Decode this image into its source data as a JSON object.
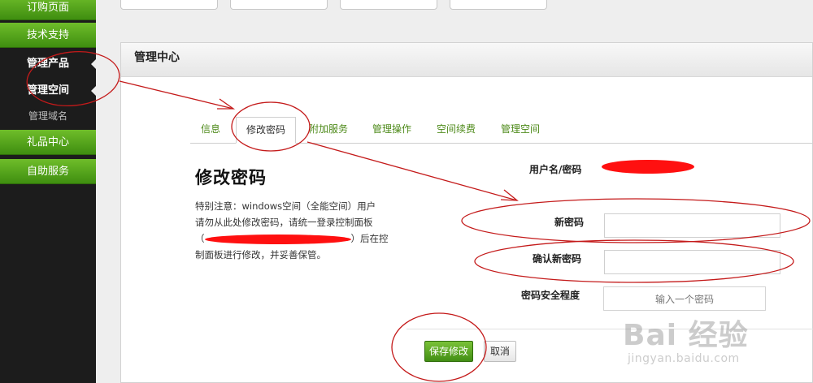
{
  "sidebar": {
    "items": [
      {
        "label": "订购页面"
      },
      {
        "label": "技术支持"
      },
      {
        "label": "管理产品"
      },
      {
        "label": "管理空间"
      },
      {
        "label": "管理域名"
      },
      {
        "label": "礼品中心"
      },
      {
        "label": "自助服务"
      }
    ]
  },
  "panel": {
    "title": "管理中心"
  },
  "tabs": [
    {
      "label": "信息"
    },
    {
      "label": "修改密码"
    },
    {
      "label": "附加服务"
    },
    {
      "label": "管理操作"
    },
    {
      "label": "空间续费"
    },
    {
      "label": "管理空间"
    }
  ],
  "section": {
    "title": "修改密码",
    "notice_line1": "特别注意：windows空间（全能空间）用户",
    "notice_line2": "请勿从此处修改密码，请统一登录控制面板",
    "notice_line3_prefix": "（",
    "notice_line3_suffix": "）后在控",
    "notice_line4": "制面板进行修改，并妥善保管。"
  },
  "form": {
    "username_label": "用户名/密码",
    "new_password_label": "新密码",
    "new_password_value": "",
    "confirm_password_label": "确认新密码",
    "confirm_password_value": "",
    "strength_label": "密码安全程度",
    "strength_placeholder": "输入一个密码"
  },
  "buttons": {
    "save": "保存修改",
    "cancel": "取消"
  },
  "watermark": {
    "main": "Bai 经验",
    "sub": "jingyan.baidu.com"
  },
  "colors": {
    "accent_green": "#4e8a1a",
    "annotation_red": "#c41a1a",
    "redaction_red": "#ff1010"
  }
}
